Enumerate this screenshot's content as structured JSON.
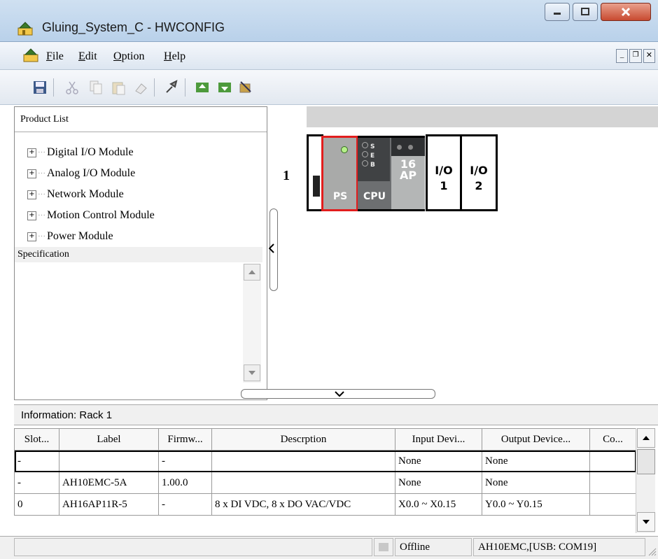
{
  "window": {
    "title": "Gluing_System_C - HWCONFIG"
  },
  "menu": {
    "file": "File",
    "edit": "Edit",
    "option": "Option",
    "help": "Help"
  },
  "product_list": {
    "header": "Product List",
    "items": [
      "Digital I/O Module",
      "Analog I/O Module",
      "Network Module",
      "Motion Control Module",
      "Power Module"
    ],
    "specification_label": "Specification"
  },
  "rack": {
    "number": "1",
    "ps_label": "PS",
    "cpu_label": "CPU",
    "cpu_leds": [
      "S",
      "E",
      "B"
    ],
    "ap_module": {
      "top": "16",
      "bottom": "AP"
    },
    "io_slots": [
      {
        "label": "I/O",
        "num": "1"
      },
      {
        "label": "I/O",
        "num": "2"
      }
    ]
  },
  "info": {
    "title": "Information: Rack 1",
    "columns": [
      "Slot...",
      "Label",
      "Firmw...",
      "Descrption",
      "Input Devi...",
      "Output Device...",
      "Co..."
    ],
    "rows": [
      [
        "-",
        "",
        "-",
        "",
        "None",
        "None",
        ""
      ],
      [
        "-",
        "AH10EMC-5A",
        "1.00.0",
        "",
        "None",
        "None",
        ""
      ],
      [
        "0",
        "AH16AP11R-5",
        "-",
        "8 x DI VDC, 8 x DO VAC/VDC",
        "X0.0 ~ X0.15",
        "Y0.0 ~ Y0.15",
        ""
      ]
    ]
  },
  "status": {
    "mode": "Offline",
    "connection": "AH10EMC,[USB: COM19]"
  },
  "colors": {
    "selection": "#e21d1d",
    "module_gray": "#a9aaa9",
    "cpu_dark": "#4b4d4f"
  }
}
